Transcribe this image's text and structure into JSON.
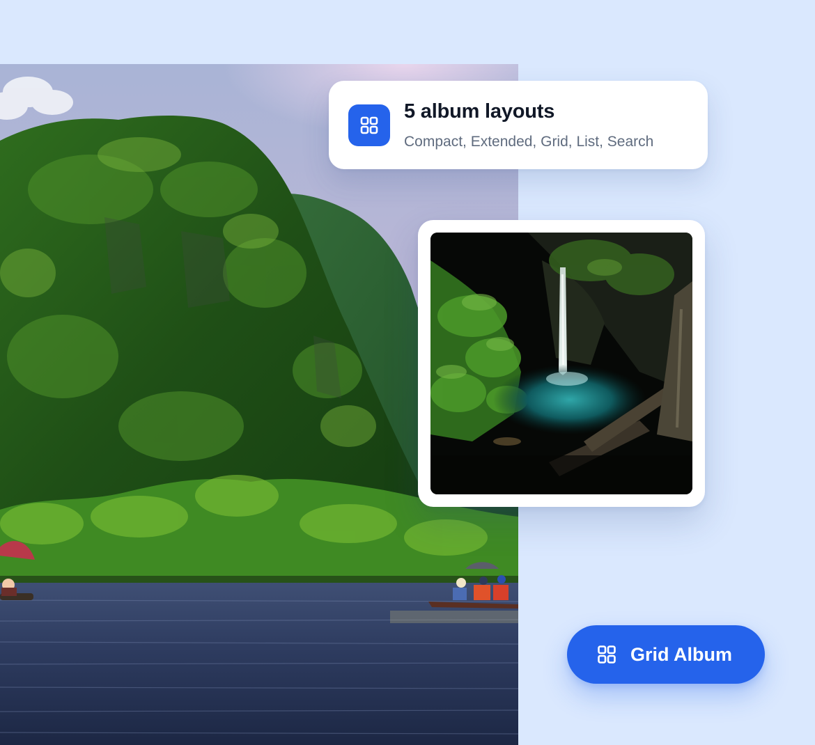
{
  "feature": {
    "icon": "grid-icon",
    "title": "5 album layouts",
    "subtitle": "Compact, Extended, Grid, List, Search"
  },
  "hero_photo": {
    "subject": "limestone karst mountain covered in forest above a river with small boats"
  },
  "gallery_photo": {
    "subject": "waterfall falling into a dark pool in a forest"
  },
  "grid_album_button": {
    "icon": "grid-icon",
    "label": "Grid Album"
  },
  "colors": {
    "background": "#dae8fe",
    "accent": "#2563eb",
    "card": "#ffffff",
    "title_text": "#111827",
    "subtitle_text": "#5f6b7e"
  }
}
